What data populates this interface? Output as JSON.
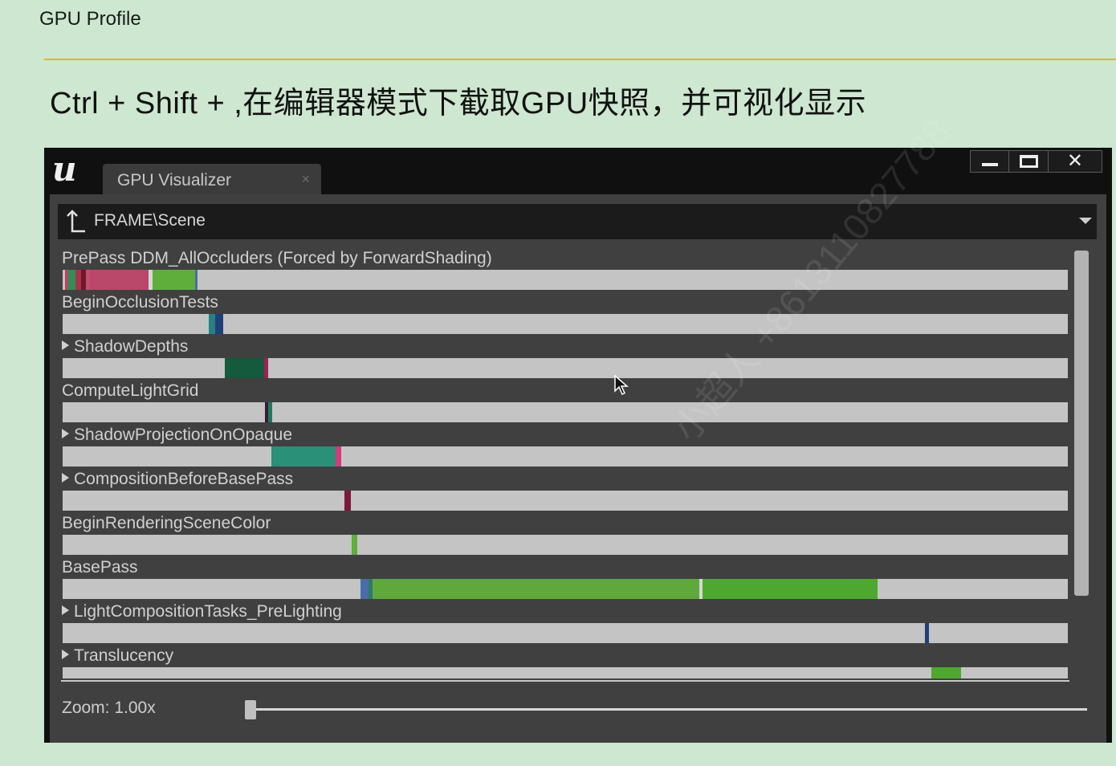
{
  "slide": {
    "title": "GPU Profile",
    "heading": "Ctrl + Shift + ,在编辑器模式下截取GPU快照，并可视化显示",
    "accent_line_color": "#e3b13c",
    "background_color": "#cde7d0"
  },
  "window": {
    "logo_text": "u",
    "tab_title": "GPU Visualizer",
    "tab_close": "×",
    "window_buttons": [
      "minimize-icon",
      "maximize-icon",
      "close-icon"
    ],
    "close_glyph": "✕"
  },
  "path_bar": {
    "path": "FRAME\\Scene",
    "up_icon": "up-folder-icon",
    "dropdown_icon": "chevron-down-icon"
  },
  "rows": [
    {
      "label": "PrePass DDM_AllOccluders (Forced by ForwardShading)",
      "expandable": false,
      "segments": [
        {
          "start": 0.0025,
          "end": 0.0055,
          "color": "#b5465f"
        },
        {
          "start": 0.0055,
          "end": 0.0125,
          "color": "#2f8f55"
        },
        {
          "start": 0.0125,
          "end": 0.0185,
          "color": "#a8324a"
        },
        {
          "start": 0.0185,
          "end": 0.0235,
          "color": "#6d1a2a"
        },
        {
          "start": 0.0235,
          "end": 0.0275,
          "color": "#c05070"
        },
        {
          "start": 0.0275,
          "end": 0.0855,
          "color": "#b9486a"
        },
        {
          "start": 0.0855,
          "end": 0.0895,
          "color": "#d6d6d6"
        },
        {
          "start": 0.0895,
          "end": 0.1315,
          "color": "#5fae3c"
        },
        {
          "start": 0.1315,
          "end": 0.1345,
          "color": "#4a6da8"
        }
      ]
    },
    {
      "label": "BeginOcclusionTests",
      "expandable": false,
      "segments": [
        {
          "start": 0.1455,
          "end": 0.1515,
          "color": "#2a8080"
        },
        {
          "start": 0.1515,
          "end": 0.1595,
          "color": "#1f3f7a"
        }
      ]
    },
    {
      "label": "ShadowDepths",
      "expandable": true,
      "segments": [
        {
          "start": 0.1615,
          "end": 0.2005,
          "color": "#145a3c"
        },
        {
          "start": 0.2005,
          "end": 0.2045,
          "color": "#a02050"
        }
      ]
    },
    {
      "label": "ComputeLightGrid",
      "expandable": false,
      "segments": [
        {
          "start": 0.2015,
          "end": 0.2045,
          "color": "#3a1a3a"
        },
        {
          "start": 0.2045,
          "end": 0.2085,
          "color": "#1f7a5a"
        }
      ]
    },
    {
      "label": "ShadowProjectionOnOpaque",
      "expandable": true,
      "segments": [
        {
          "start": 0.2075,
          "end": 0.2715,
          "color": "#2a9077"
        },
        {
          "start": 0.2715,
          "end": 0.2775,
          "color": "#d13d7c"
        }
      ]
    },
    {
      "label": "CompositionBeforeBasePass",
      "expandable": true,
      "segments": [
        {
          "start": 0.2805,
          "end": 0.2865,
          "color": "#7a1a3a"
        }
      ]
    },
    {
      "label": "BeginRenderingSceneColor",
      "expandable": false,
      "segments": [
        {
          "start": 0.2875,
          "end": 0.2935,
          "color": "#5fae3c"
        }
      ]
    },
    {
      "label": "BasePass",
      "expandable": false,
      "segments": [
        {
          "start": 0.2965,
          "end": 0.3045,
          "color": "#4a6da8"
        },
        {
          "start": 0.3045,
          "end": 0.3085,
          "color": "#2f7a6a"
        },
        {
          "start": 0.3085,
          "end": 0.6335,
          "color": "#5ea83c"
        },
        {
          "start": 0.6335,
          "end": 0.6365,
          "color": "#d6d6d6"
        },
        {
          "start": 0.6365,
          "end": 0.8105,
          "color": "#4ea830"
        }
      ]
    },
    {
      "label": "LightCompositionTasks_PreLighting",
      "expandable": true,
      "segments": [
        {
          "start": 0.8575,
          "end": 0.8615,
          "color": "#1f3f7a"
        }
      ]
    },
    {
      "label": "Translucency",
      "expandable": true,
      "segments": [
        {
          "start": 0.8645,
          "end": 0.8935,
          "color": "#4ea830"
        }
      ]
    }
  ],
  "zoom": {
    "label": "Zoom: 1.00x",
    "value": 0
  },
  "watermark": "小超人 +8613110827788",
  "cursor_icon": "mouse-pointer-icon"
}
